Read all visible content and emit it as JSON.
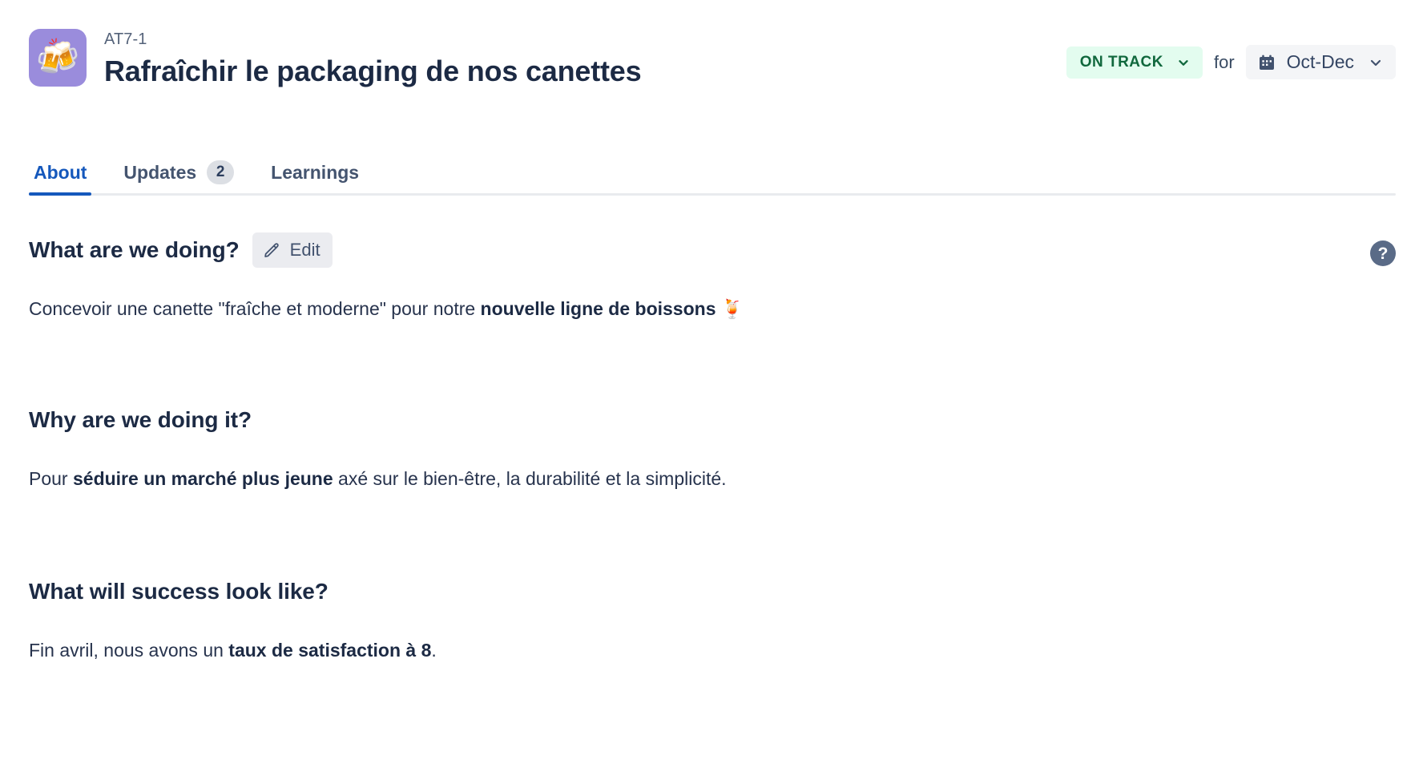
{
  "header": {
    "app_icon": "beer-mugs-emoji",
    "app_icon_glyph": "🍻",
    "app_icon_bg": "#9a8cdc",
    "project_key": "AT7-1",
    "project_title": "Rafraîchir le packaging de nos canettes",
    "status": {
      "label": "ON TRACK",
      "bg": "#e3fcef",
      "color": "#10683d",
      "chevron": "chevron-down-icon"
    },
    "for_label": "for",
    "date_range": {
      "label": "Oct-Dec",
      "icon": "calendar-icon",
      "chevron": "chevron-down-icon"
    }
  },
  "tabs": [
    {
      "label": "About",
      "active": true,
      "badge": null
    },
    {
      "label": "Updates",
      "active": false,
      "badge": "2"
    },
    {
      "label": "Learnings",
      "active": false,
      "badge": null
    }
  ],
  "sections": [
    {
      "title": "What are we doing?",
      "edit_label": "Edit",
      "edit_icon": "pencil-icon",
      "body_parts": [
        {
          "text": "Concevoir une canette \"fraîche et moderne\" pour notre ",
          "bold": false
        },
        {
          "text": "nouvelle ligne de boissons",
          "bold": true
        },
        {
          "text": " 🍹",
          "bold": false
        }
      ]
    },
    {
      "title": "Why are we doing it?",
      "edit_label": null,
      "body_parts": [
        {
          "text": "Pour ",
          "bold": false
        },
        {
          "text": "séduire un marché plus jeune",
          "bold": true
        },
        {
          "text": " axé sur le bien-être, la durabilité et la simplicité.",
          "bold": false
        }
      ]
    },
    {
      "title": "What will success look like?",
      "edit_label": null,
      "body_parts": [
        {
          "text": "Fin avril, nous avons un ",
          "bold": false
        },
        {
          "text": "taux de satisfaction à 8",
          "bold": true
        },
        {
          "text": ".",
          "bold": false
        }
      ]
    }
  ],
  "help": {
    "label": "?",
    "icon": "help-circle-icon"
  },
  "colors": {
    "accent_blue": "#1558bc",
    "text_dark": "#1c2a44",
    "text_body": "#27334d",
    "text_muted": "#55637a",
    "divider": "#e9ebee"
  }
}
